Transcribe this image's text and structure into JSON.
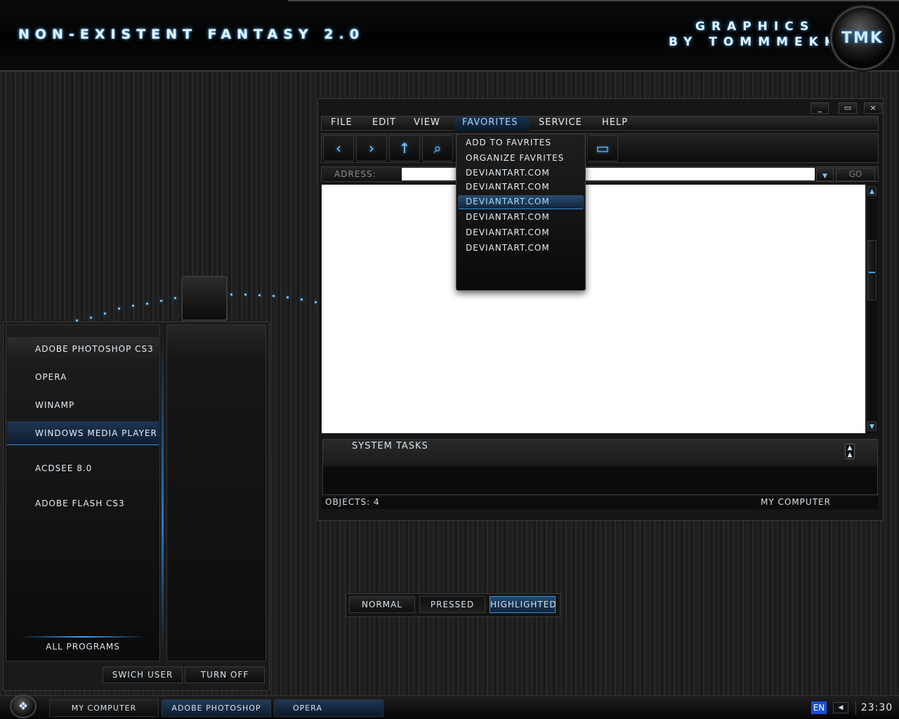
{
  "banner": {
    "title": "NON-EXISTENT FANTASY 2.0",
    "credit_line1": "GRAPHICS",
    "credit_line2": "BY TOMMMEKK",
    "logo_text": "TMK"
  },
  "start_menu": {
    "programs": [
      "ADOBE PHOTOSHOP CS3",
      "OPERA",
      "WINAMP",
      "WINDOWS MEDIA PLAYER",
      "ACDSEE 8.0",
      "ADOBE FLASH CS3"
    ],
    "all_programs": "ALL PROGRAMS",
    "switch_user": "SWICH USER",
    "turn_off": "TURN OFF"
  },
  "window": {
    "controls": {
      "minimize": "_",
      "maximize": "▭",
      "close": "×"
    },
    "menu": [
      "FILE",
      "EDIT",
      "VIEW",
      "FAVORITES",
      "SERVICE",
      "HELP"
    ],
    "toolbar_icons": [
      "back-icon",
      "forward-icon",
      "up-icon",
      "search-icon",
      "folders-icon"
    ],
    "address_label": "ADRESS:",
    "address_value": "",
    "go_label": "GO",
    "tasks_title": "SYSTEM TASKS",
    "status_left": "OBJECTS:  4",
    "status_right": "MY COMPUTER"
  },
  "favorites_menu": {
    "items": [
      "ADD TO FAVRITES",
      "ORGANIZE FAVRITES",
      "DEVIANTART.COM",
      "DEVIANTART.COM",
      "DEVIANTART.COM",
      "DEVIANTART.COM",
      "DEVIANTART.COM",
      "DEVIANTART.COM"
    ]
  },
  "button_states": [
    "NORMAL",
    "PRESSED",
    "HIGHLIGHTED"
  ],
  "taskbar": {
    "tasks": [
      "MY COMPUTER",
      "ADOBE PHOTOSHOP",
      "OPERA"
    ],
    "language": "EN",
    "clock": "23:30"
  },
  "colors": {
    "accent": "#2ea4ff",
    "highlight": "#1c3550",
    "background": "#202020"
  }
}
